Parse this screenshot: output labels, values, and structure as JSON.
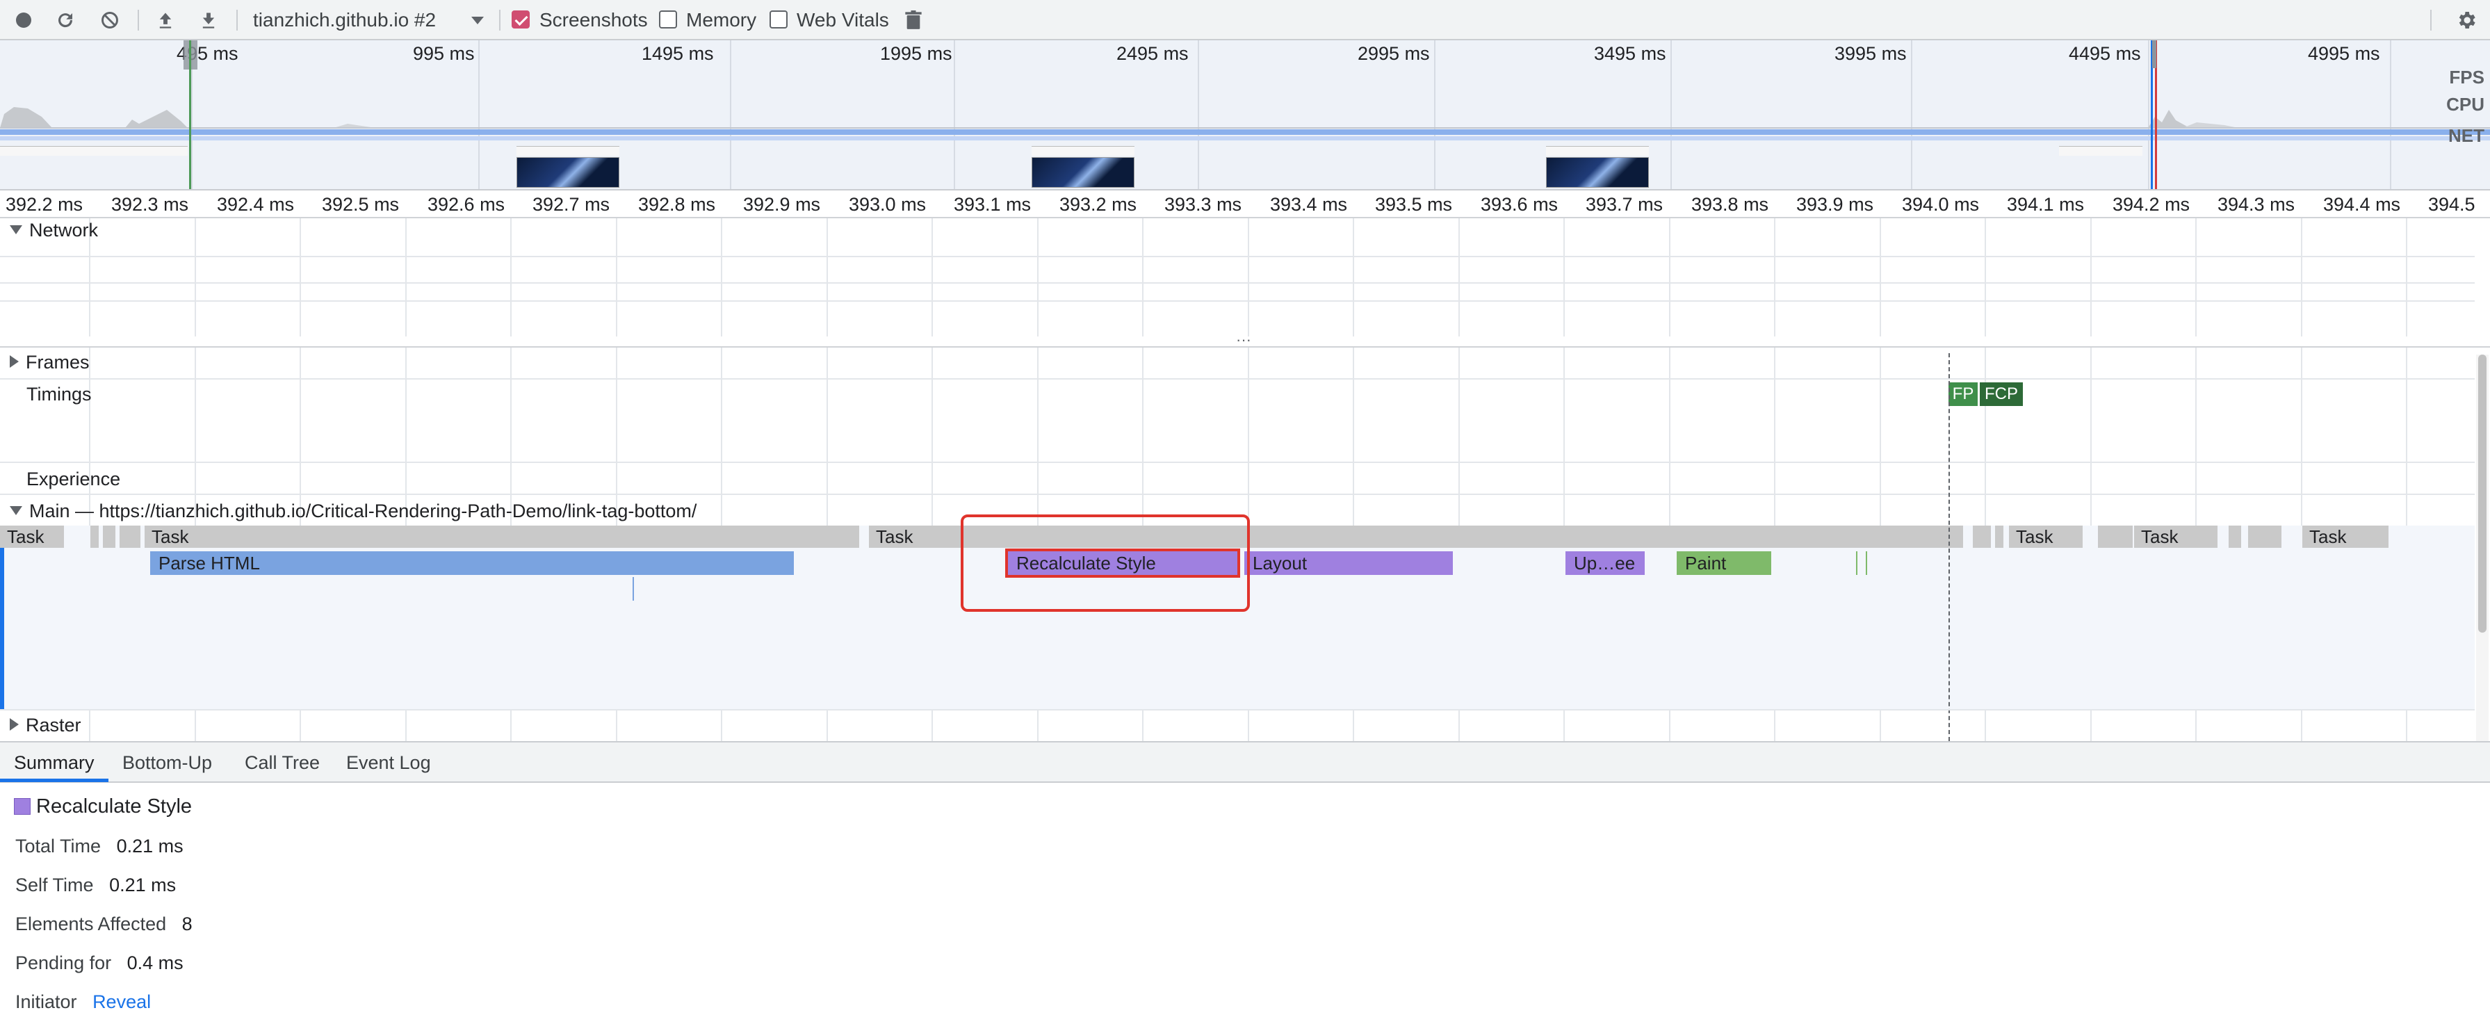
{
  "toolbar": {
    "profile_select": "tianzhich.github.io #2",
    "screenshots_label": "Screenshots",
    "screenshots_checked": true,
    "memory_label": "Memory",
    "memory_checked": false,
    "web_vitals_label": "Web Vitals",
    "web_vitals_checked": false
  },
  "overview": {
    "tick_labels": [
      "495 ms",
      "995 ms",
      "1495 ms",
      "1995 ms",
      "2495 ms",
      "2995 ms",
      "3495 ms",
      "3995 ms",
      "4495 ms",
      "4995 ms"
    ],
    "row_labels": [
      "FPS",
      "CPU",
      "NET"
    ]
  },
  "ruler": {
    "labels": [
      "392.2 ms",
      "392.3 ms",
      "392.4 ms",
      "392.5 ms",
      "392.6 ms",
      "392.7 ms",
      "392.8 ms",
      "392.9 ms",
      "393.0 ms",
      "393.1 ms",
      "393.2 ms",
      "393.3 ms",
      "393.4 ms",
      "393.5 ms",
      "393.6 ms",
      "393.7 ms",
      "393.8 ms",
      "393.9 ms",
      "394.0 ms",
      "394.1 ms",
      "394.2 ms",
      "394.3 ms",
      "394.4 ms",
      "394.5"
    ]
  },
  "tracks": {
    "network": "Network",
    "frames": "Frames",
    "timings": "Timings",
    "experience": "Experience",
    "main": "Main — https://tianzhich.github.io/Critical-Rendering-Path-Demo/link-tag-bottom/",
    "raster": "Raster"
  },
  "timings_markers": {
    "fp": "FP",
    "fcp": "FCP"
  },
  "main_tasks": {
    "task_label": "Task"
  },
  "main_events": {
    "parse_html": "Parse HTML",
    "recalculate_style": "Recalculate Style",
    "layout": "Layout",
    "update_layer_tree": "Up…ee",
    "paint": "Paint"
  },
  "colors": {
    "parse_html": "#7aa3e0",
    "recalculate_style": "#9f80e0",
    "layout": "#9f80e0",
    "paint": "#7fba6a",
    "task": "#c9c9c9",
    "fp": "#3f8f4a",
    "fcp": "#2d6a37",
    "highlight": "#e0342c"
  },
  "bottom_tabs": [
    "Summary",
    "Bottom-Up",
    "Call Tree",
    "Event Log"
  ],
  "summary": {
    "title": "Recalculate Style",
    "total_time_label": "Total Time",
    "total_time": "0.21 ms",
    "self_time_label": "Self Time",
    "self_time": "0.21 ms",
    "elements_affected_label": "Elements Affected",
    "elements_affected": "8",
    "pending_for_label": "Pending for",
    "pending_for": "0.4 ms",
    "initiator_label": "Initiator",
    "initiator_link": "Reveal"
  }
}
